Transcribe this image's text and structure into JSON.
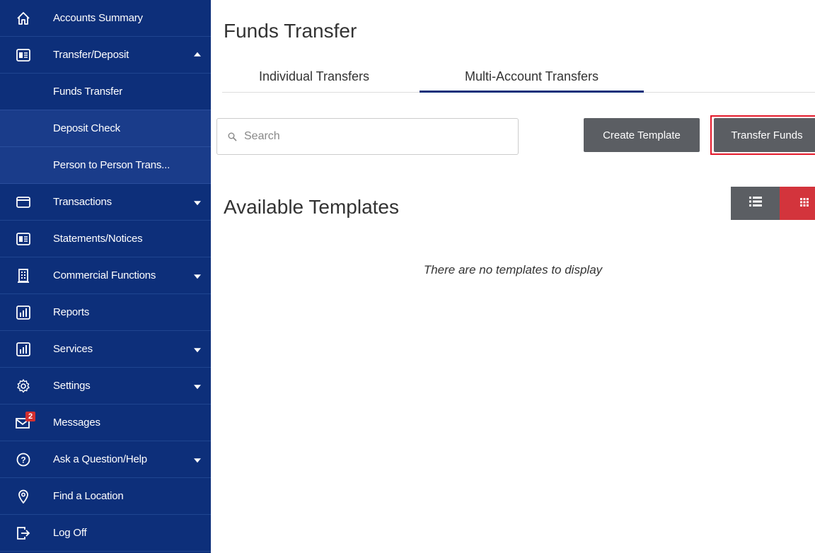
{
  "sidebar": {
    "items": [
      {
        "label": "Accounts Summary",
        "icon": "home-icon"
      },
      {
        "label": "Transfer/Deposit",
        "icon": "transfer-icon",
        "arrow": "up"
      },
      {
        "label": "Funds Transfer",
        "sub": true,
        "active": true
      },
      {
        "label": "Deposit Check",
        "sub": true
      },
      {
        "label": "Person to Person Trans...",
        "sub": true
      },
      {
        "label": "Transactions",
        "icon": "card-icon",
        "arrow": "down"
      },
      {
        "label": "Statements/Notices",
        "icon": "statement-icon"
      },
      {
        "label": "Commercial Functions",
        "icon": "building-icon",
        "arrow": "down"
      },
      {
        "label": "Reports",
        "icon": "report-icon"
      },
      {
        "label": "Services",
        "icon": "services-icon",
        "arrow": "down"
      },
      {
        "label": "Settings",
        "icon": "gear-icon",
        "arrow": "down"
      },
      {
        "label": "Messages",
        "icon": "mail-icon",
        "badge": "2"
      },
      {
        "label": "Ask a Question/Help",
        "icon": "help-icon",
        "arrow": "down"
      },
      {
        "label": "Find a Location",
        "icon": "location-icon"
      },
      {
        "label": "Log Off",
        "icon": "logoff-icon"
      }
    ]
  },
  "main": {
    "title": "Funds Transfer",
    "tabs": [
      {
        "label": "Individual Transfers",
        "active": false
      },
      {
        "label": "Multi-Account Transfers",
        "active": true
      }
    ],
    "search": {
      "placeholder": "Search",
      "value": ""
    },
    "buttons": {
      "create_template": "Create Template",
      "transfer_funds": "Transfer Funds"
    },
    "section_title": "Available Templates",
    "empty_message": "There are no templates to display"
  },
  "colors": {
    "sidebar_bg": "#0d2f7a",
    "sidebar_sub_bg": "#1a3c8a",
    "button_gray": "#5b5e63",
    "accent_red": "#d3343c",
    "highlight_red": "#e3182a"
  }
}
